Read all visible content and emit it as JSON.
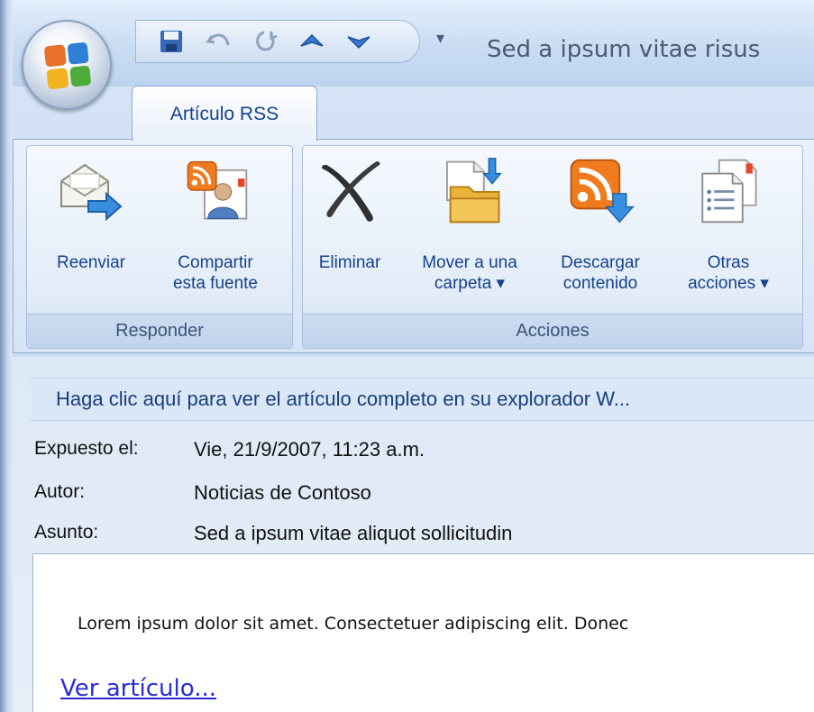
{
  "window": {
    "title": "Sed a ipsum vitae risus"
  },
  "quick_access": {
    "buttons": [
      "save-icon",
      "undo-icon",
      "redo-icon",
      "previous-item-icon",
      "next-item-icon"
    ],
    "more": "▾"
  },
  "ribbon": {
    "tab": "Artículo RSS",
    "groups": [
      {
        "label": "Responder",
        "buttons": [
          {
            "line1": "Reenviar",
            "line2": "",
            "icon": "forward-mail-icon"
          },
          {
            "line1": "Compartir",
            "line2": "esta fuente",
            "icon": "share-feed-icon"
          }
        ]
      },
      {
        "label": "Acciones",
        "buttons": [
          {
            "line1": "Eliminar",
            "line2": "",
            "icon": "delete-x-icon"
          },
          {
            "line1": "Mover a una",
            "line2": "carpeta ▾",
            "icon": "move-to-folder-icon"
          },
          {
            "line1": "Descargar",
            "line2": "contenido",
            "icon": "download-rss-icon"
          },
          {
            "line1": "Otras",
            "line2": "acciones ▾",
            "icon": "other-actions-icon"
          }
        ]
      }
    ]
  },
  "infobar": "Haga clic aquí para ver el artículo completo en su explorador W...",
  "meta": {
    "posted_label": "Expuesto el:",
    "posted_value": "Vie, 21/9/2007, 11:23 a.m.",
    "author_label": "Autor:",
    "author_value": "Noticias de Contoso",
    "subject_label": "Asunto:",
    "subject_value": "Sed a ipsum vitae aliquot sollicitudin"
  },
  "body": {
    "text": "Lorem ipsum dolor sit amet. Consectetuer adipiscing elit. Donec",
    "link": "Ver artículo..."
  },
  "colors": {
    "accent": "#15428b",
    "link": "#2b2bd8",
    "rss_orange": "#f07b1e"
  }
}
